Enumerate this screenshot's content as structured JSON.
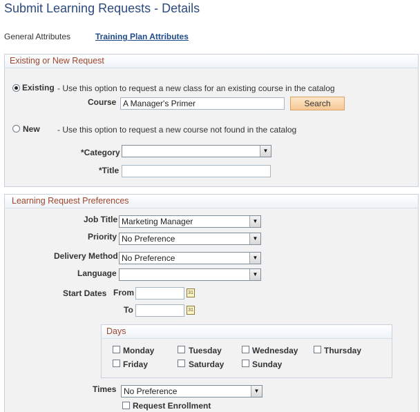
{
  "page": {
    "title": "Submit Learning Requests - Details"
  },
  "tabs": {
    "general": "General Attributes",
    "training_plan": "Training Plan Attributes"
  },
  "request_group": {
    "header": "Existing or New Request",
    "existing_label": "Existing",
    "existing_desc": "- Use this option to request a new class for an existing course in the catalog",
    "existing_selected": true,
    "course_label": "Course",
    "course_value": "A Manager's Primer",
    "search_button": "Search",
    "new_label": "New",
    "new_desc": "- Use this option to request a new course not found in the catalog",
    "category_label": "*Category",
    "category_value": "",
    "title_label": "*Title",
    "title_value": ""
  },
  "preferences": {
    "header": "Learning Request Preferences",
    "job_title_label": "Job Title",
    "job_title_value": "Marketing Manager",
    "priority_label": "Priority",
    "priority_value": "No Preference",
    "delivery_label": "Delivery Method",
    "delivery_value": "No Preference",
    "language_label": "Language",
    "language_value": "",
    "start_dates_label": "Start Dates",
    "from_label": "From",
    "to_label": "To",
    "from_value": "",
    "to_value": "",
    "calendar_glyph": "31",
    "days": {
      "header": "Days",
      "items": [
        "Monday",
        "Tuesday",
        "Wednesday",
        "Thursday",
        "Friday",
        "Saturday",
        "Sunday"
      ]
    },
    "times_label": "Times",
    "times_value": "No Preference",
    "request_enrollment_label": "Request Enrollment"
  },
  "icons": {
    "dropdown": "chevron-down-icon",
    "calendar": "calendar-icon"
  },
  "colors": {
    "title": "#2d4a7c",
    "group_header_text": "#a1452c",
    "button": "#f6c794"
  }
}
